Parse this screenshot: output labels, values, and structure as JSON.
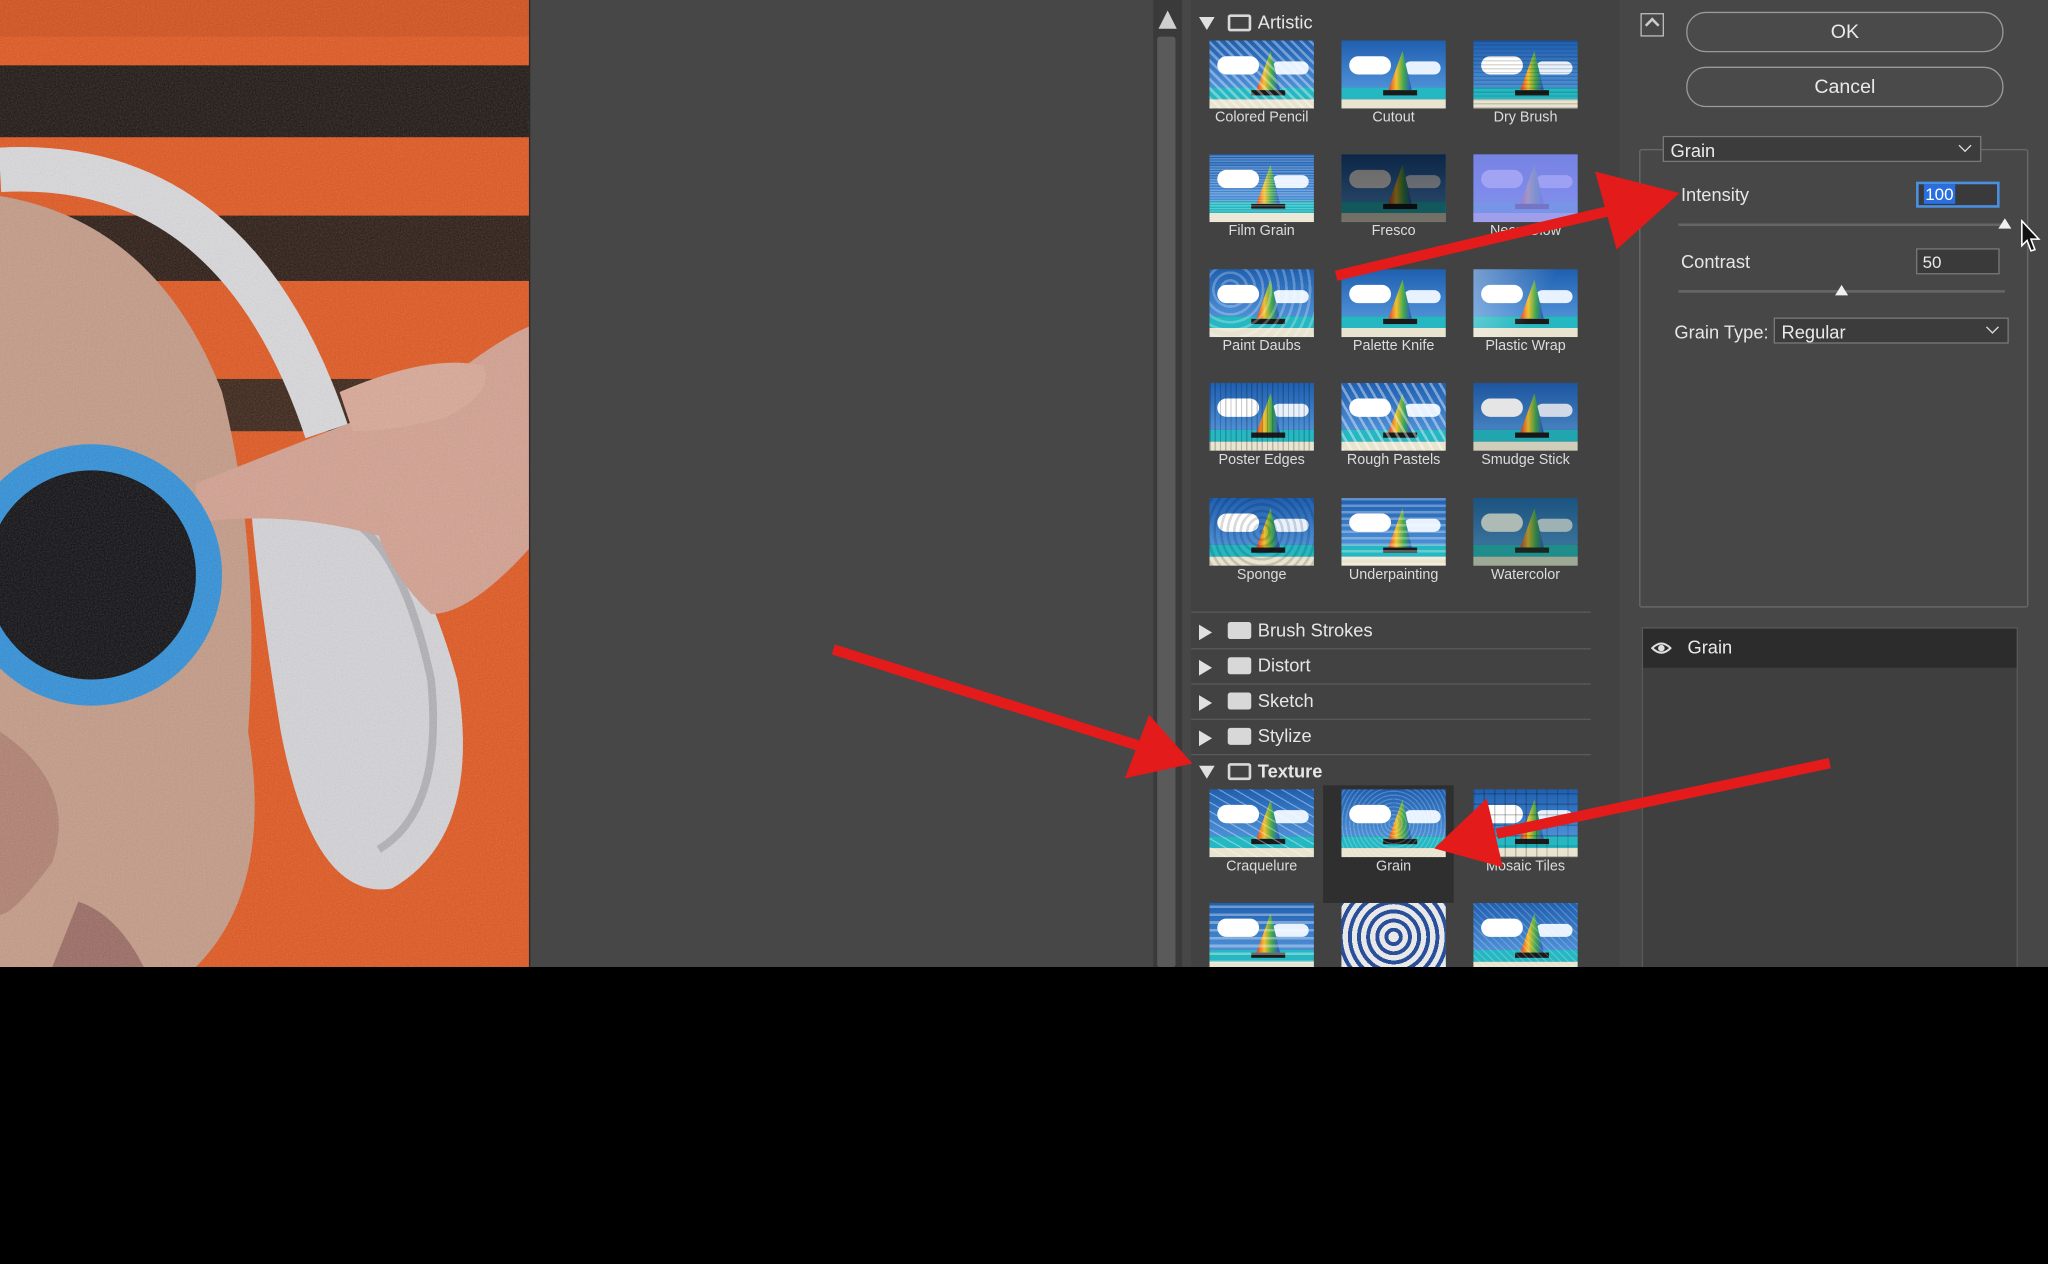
{
  "dialog": {
    "ok_label": "OK",
    "cancel_label": "Cancel"
  },
  "gallery": {
    "artistic": {
      "label": "Artistic",
      "items": [
        {
          "label": "Colored Pencil"
        },
        {
          "label": "Cutout"
        },
        {
          "label": "Dry Brush"
        },
        {
          "label": "Film Grain"
        },
        {
          "label": "Fresco"
        },
        {
          "label": "Neon Glow"
        },
        {
          "label": "Paint Daubs"
        },
        {
          "label": "Palette Knife"
        },
        {
          "label": "Plastic Wrap"
        },
        {
          "label": "Poster Edges"
        },
        {
          "label": "Rough Pastels"
        },
        {
          "label": "Smudge Stick"
        },
        {
          "label": "Sponge"
        },
        {
          "label": "Underpainting"
        },
        {
          "label": "Watercolor"
        }
      ]
    },
    "collapsed_groups": [
      {
        "label": "Brush Strokes"
      },
      {
        "label": "Distort"
      },
      {
        "label": "Sketch"
      },
      {
        "label": "Stylize"
      }
    ],
    "texture": {
      "label": "Texture",
      "items": [
        {
          "label": "Craquelure"
        },
        {
          "label": "Grain"
        },
        {
          "label": "Mosaic Tiles"
        }
      ]
    }
  },
  "settings": {
    "filter_select": "Grain",
    "intensity": {
      "label": "Intensity",
      "value": "100",
      "slider_level": 1.0
    },
    "contrast": {
      "label": "Contrast",
      "value": "50",
      "slider_level": 0.5
    },
    "grain_type": {
      "label": "Grain Type:",
      "value": "Regular"
    }
  },
  "layers": {
    "items": [
      {
        "label": "Grain"
      }
    ]
  },
  "icons": {
    "collapse": "collapse-icon",
    "eye": "eye-icon",
    "folder": "folder-icon"
  },
  "colors": {
    "annotation_arrow": "#e31b1b",
    "selection_highlight": "#2a6fe0"
  }
}
